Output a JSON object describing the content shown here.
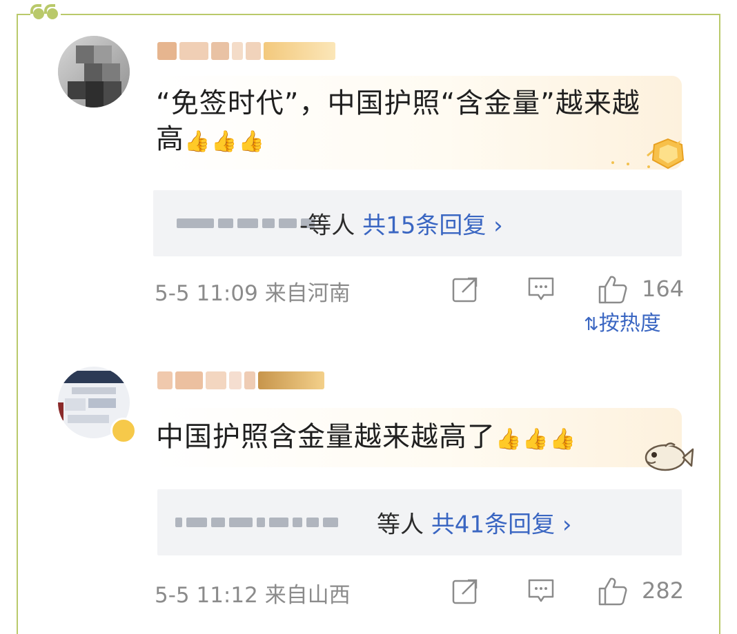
{
  "comments": [
    {
      "content": "“免签时代”，中国护照“含金量”越来越高",
      "content_emoji": "👍👍👍",
      "reply_suffix": "-等人",
      "reply_count_label": "共15条回复 ›",
      "time": "5-5 11:09",
      "location": "来自河南",
      "likes": "164"
    },
    {
      "content": "中国护照含金量越来越高了",
      "content_emoji": "👍👍👍",
      "reply_suffix": "等人",
      "reply_count_label": "共41条回复 ›",
      "time": "5-5 11:12",
      "location": "来自山西",
      "likes": "282"
    }
  ],
  "sort_toggle": {
    "icon": "sort-icon",
    "label": "按热度"
  },
  "colors": {
    "frame": "#b9c96a",
    "link": "#3a66c2",
    "meta": "#8b8b8b",
    "reply_bg": "#f2f3f5"
  }
}
